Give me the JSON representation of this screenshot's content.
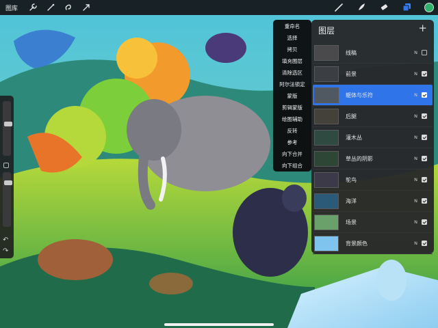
{
  "app": {
    "gallery_label": "图库"
  },
  "toolbar": {
    "left_icons": [
      "wrench-icon",
      "magic-wand-icon",
      "selection-icon",
      "transform-arrow-icon"
    ],
    "right_tools": [
      "brush-icon",
      "smudge-icon",
      "eraser-icon",
      "layers-icon"
    ],
    "current_color": "#2fb36b"
  },
  "layer_menu": {
    "items": [
      "重命名",
      "选择",
      "拷贝",
      "填充图层",
      "清除选区",
      "阿尔法锁定",
      "蒙版",
      "剪辑蒙版",
      "绘图辅助",
      "反转",
      "参考",
      "向下合并",
      "向下组合"
    ]
  },
  "layers_panel": {
    "title": "图层",
    "add_label": "+",
    "layers": [
      {
        "name": "线稿",
        "blend": "N",
        "visible": false,
        "selected": false,
        "thumb": "#4a4a4c"
      },
      {
        "name": "前景",
        "blend": "N",
        "visible": true,
        "selected": false,
        "thumb": "#3b3f44"
      },
      {
        "name": "躯体与乐符",
        "blend": "N",
        "visible": true,
        "selected": true,
        "thumb": "#505862"
      },
      {
        "name": "后腿",
        "blend": "N",
        "visible": true,
        "selected": false,
        "thumb": "#44403a"
      },
      {
        "name": "灌木丛",
        "blend": "N",
        "visible": true,
        "selected": false,
        "thumb": "#2f4a40"
      },
      {
        "name": "草丛的阴影",
        "blend": "N",
        "visible": true,
        "selected": false,
        "thumb": "#2e4636"
      },
      {
        "name": "鸵鸟",
        "blend": "N",
        "visible": true,
        "selected": false,
        "thumb": "#3c3a48"
      },
      {
        "name": "海洋",
        "blend": "N",
        "visible": true,
        "selected": false,
        "thumb": "#2a5a78"
      },
      {
        "name": "场景",
        "blend": "N",
        "visible": true,
        "selected": false,
        "thumb": "#6aa06a"
      },
      {
        "name": "背景颜色",
        "blend": "N",
        "visible": true,
        "selected": false,
        "thumb": "#7ec4ee"
      }
    ]
  },
  "colors": {
    "accent": "#2f74e8",
    "panel": "#28282a",
    "toolbar": "#141416"
  }
}
